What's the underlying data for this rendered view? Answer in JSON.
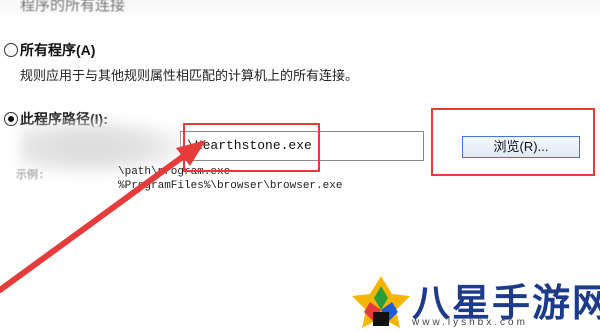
{
  "top_text": "程序的所有连接",
  "options": {
    "all_programs": {
      "label": "所有程序(A)",
      "description": "规则应用于与其他规则属性相匹配的计算机上的所有连接。",
      "checked": false
    },
    "this_program": {
      "label": "此程序路径(I):",
      "checked": true
    }
  },
  "path_input": {
    "value": "\\Hearthstone.exe"
  },
  "browse_button": {
    "label": "浏览(R)..."
  },
  "example": {
    "label": "示例:",
    "line1": "\\path\\program.exe",
    "line2": "%ProgramFiles%\\browser\\browser.exe"
  },
  "watermark": {
    "brand": "八星手游网",
    "url": "www.lyshbx.com"
  },
  "colors": {
    "highlight_red": "#e53b3b",
    "button_border": "#3a7bd5",
    "watermark_blue": "#1e3a8a"
  }
}
